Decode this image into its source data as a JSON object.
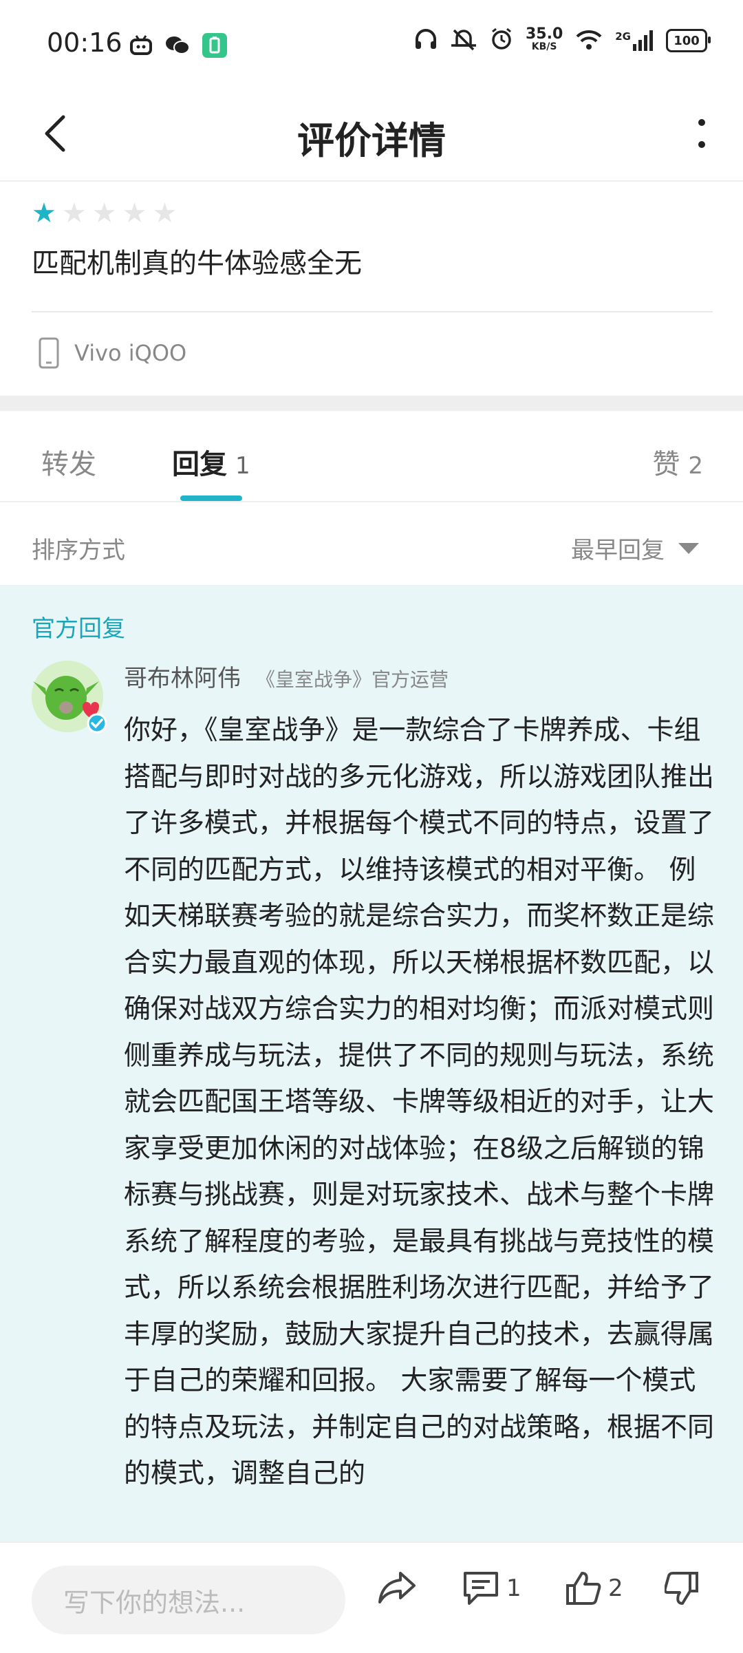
{
  "status_bar": {
    "time": "00:16",
    "net_speed_value": "35.0",
    "net_speed_unit": "KB/S",
    "signal_label": "2G",
    "battery": "100"
  },
  "header": {
    "title": "评价详情"
  },
  "review": {
    "rating": 1,
    "max_rating": 5,
    "text": "匹配机制真的牛体验感全无",
    "device": "Vivo iQOO"
  },
  "tabs": [
    {
      "label": "转发",
      "count": ""
    },
    {
      "label": "回复",
      "count": "1"
    },
    {
      "label": "赞",
      "count": "2"
    }
  ],
  "sort": {
    "label": "排序方式",
    "value": "最早回复"
  },
  "official_reply": {
    "section_title": "官方回复",
    "author": "哥布林阿伟",
    "author_subtitle": "《皇室战争》官方运营",
    "body": "你好，《皇室战争》是一款综合了卡牌养成、卡组搭配与即时对战的多元化游戏，所以游戏团队推出了许多模式，并根据每个模式不同的特点，设置了不同的匹配方式，以维持该模式的相对平衡。 例如天梯联赛考验的就是综合实力，而奖杯数正是综合实力最直观的体现，所以天梯根据杯数匹配，以确保对战双方综合实力的相对均衡；而派对模式则侧重养成与玩法，提供了不同的规则与玩法，系统就会匹配国王塔等级、卡牌等级相近的对手，让大家享受更加休闲的对战体验；在8级之后解锁的锦标赛与挑战赛，则是对玩家技术、战术与整个卡牌系统了解程度的考验，是最具有挑战与竞技性的模式，所以系统会根据胜利场次进行匹配，并给予了丰厚的奖励，鼓励大家提升自己的技术，去赢得属于自己的荣耀和回报。 大家需要了解每一个模式的特点及玩法，并制定自己的对战策略，根据不同的模式，调整自己的"
  },
  "bottom_bar": {
    "input_placeholder": "写下你的想法...",
    "comment_count": "1",
    "like_count": "2"
  },
  "colors": {
    "accent": "#1fb4c8",
    "official_bg": "#e8f6f8"
  }
}
